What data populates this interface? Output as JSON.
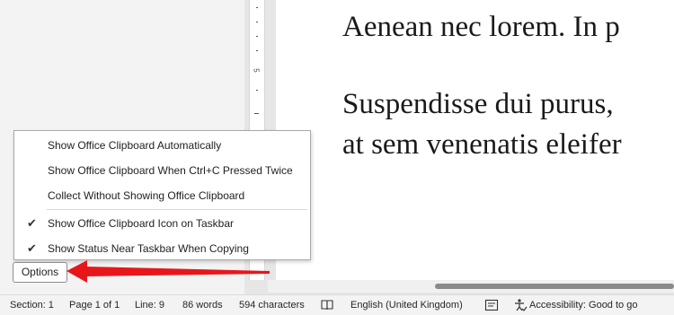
{
  "ruler": {
    "number": "5"
  },
  "document": {
    "lines": [
      "Aenean nec lorem. In p",
      "Suspendisse dui purus,",
      "at sem venenatis eleifer"
    ]
  },
  "menu": {
    "items": [
      {
        "label": "Show Office Clipboard Automatically",
        "checked": false
      },
      {
        "label": "Show Office Clipboard When Ctrl+C Pressed Twice",
        "checked": false
      },
      {
        "label": "Collect Without Showing Office Clipboard",
        "checked": false
      },
      {
        "label": "Show Office Clipboard Icon on Taskbar",
        "checked": true
      },
      {
        "label": "Show Status Near Taskbar When Copying",
        "checked": true
      }
    ],
    "check_glyph": "✔"
  },
  "options_button": {
    "label": "Options"
  },
  "annotation": {
    "arrow_color": "#e8161b"
  },
  "status_bar": {
    "section": "Section: 1",
    "page": "Page 1 of 1",
    "line": "Line: 9",
    "words": "86 words",
    "characters": "594 characters",
    "proofing_icon": "book-check-icon",
    "language": "English (United Kingdom)",
    "focus_icon": "text-predictions-icon",
    "accessibility": "Accessibility: Good to go"
  }
}
